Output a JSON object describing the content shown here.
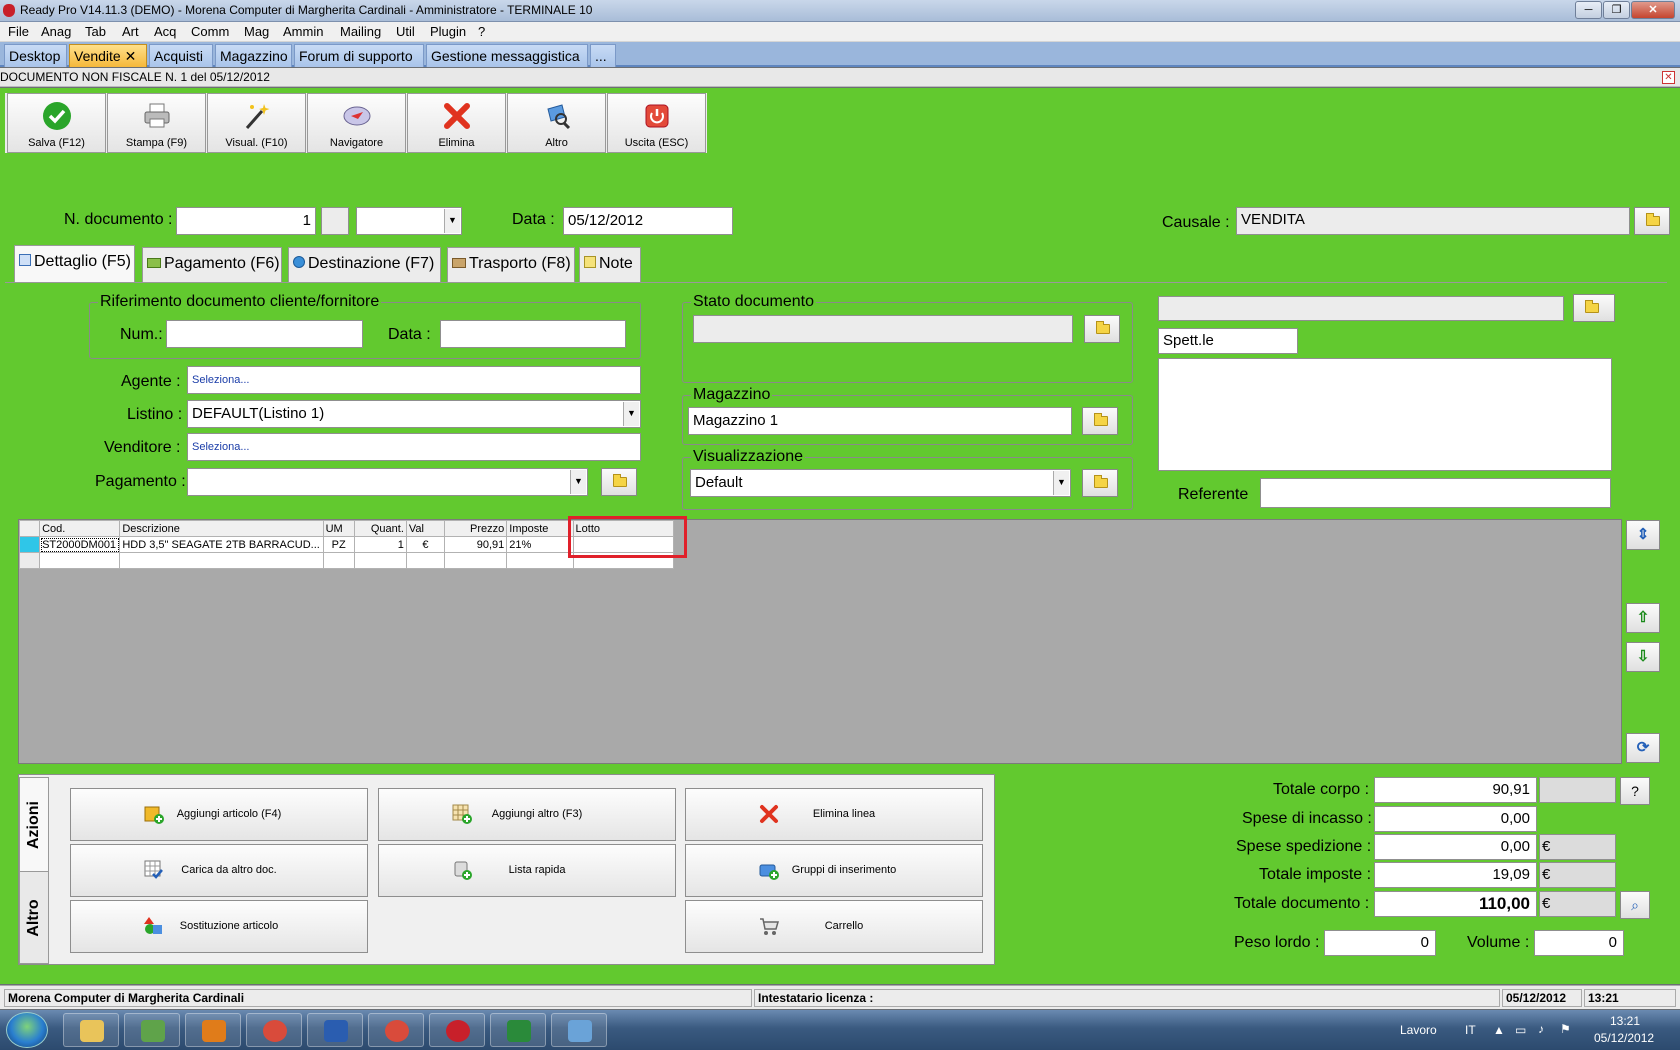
{
  "window": {
    "title": "Ready Pro V14.11.3 (DEMO)  - Morena Computer di Margherita Cardinali - Amministratore - TERMINALE 10"
  },
  "menu": [
    "File",
    "Anag",
    "Tab",
    "Art",
    "Acq",
    "Comm",
    "Mag",
    "Ammin",
    "Mailing",
    "Util",
    "Plugin",
    "?"
  ],
  "app_tabs": [
    {
      "label": "Desktop"
    },
    {
      "label": "Vendite ✕",
      "active": true
    },
    {
      "label": "Acquisti"
    },
    {
      "label": "Magazzino"
    },
    {
      "label": "Forum di supporto"
    },
    {
      "label": "Gestione messaggistica"
    },
    {
      "label": "..."
    }
  ],
  "document": {
    "header": "DOCUMENTO NON FISCALE N. 1  del 05/12/2012"
  },
  "toolbar": {
    "save": "Salva (F12)",
    "print": "Stampa (F9)",
    "view": "Visual. (F10)",
    "navigator": "Navigatore",
    "delete": "Elimina",
    "other": "Altro",
    "exit": "Uscita (ESC)"
  },
  "form": {
    "doc_number_label": "N. documento :",
    "doc_number": "1",
    "series": "",
    "date_label": "Data :",
    "date": "05/12/2012",
    "causale_label": "Causale :",
    "causale": "VENDITA"
  },
  "inner_tabs": {
    "detail": "Dettaglio (F5)",
    "payment": "Pagamento (F6)",
    "destination": "Destinazione (F7)",
    "transport": "Trasporto (F8)",
    "notes": "Note"
  },
  "detail": {
    "ref_group": "Riferimento documento cliente/fornitore",
    "num_label": "Num.:",
    "num": "",
    "ref_date_label": "Data :",
    "ref_date": "",
    "agent_label": "Agente :",
    "agent": "Seleziona...",
    "listino_label": "Listino :",
    "listino": "DEFAULT(Listino 1)",
    "seller_label": "Venditore :",
    "seller": "Seleziona...",
    "payment_label": "Pagamento :",
    "payment": "",
    "status_group": "Stato documento",
    "status": "",
    "warehouse_group": "Magazzino",
    "warehouse": "Magazzino 1",
    "view_group": "Visualizzazione",
    "view": "Default",
    "customer_name": "",
    "salutation": "Spett.le",
    "address": "",
    "referente_label": "Referente",
    "referente": ""
  },
  "grid": {
    "columns": [
      "Cod.",
      "Descrizione",
      "UM",
      "Quant.",
      "Val",
      "Prezzo",
      "Imposte",
      "Lotto"
    ],
    "rows": [
      [
        "ST2000DM001",
        "HDD 3,5\" SEAGATE 2TB BARRACUD...",
        "PZ",
        "1",
        "€",
        "90,91",
        "21%",
        ""
      ]
    ]
  },
  "actions": {
    "tab_actions": "Azioni",
    "tab_other": "Altro",
    "add_article": "Aggiungi articolo (F4)",
    "add_other": "Aggiungi altro (F3)",
    "delete_line": "Elimina linea",
    "load_doc": "Carica da altro doc.",
    "quick_list": "Lista rapida",
    "insert_groups": "Gruppi di inserimento",
    "replace": "Sostituzione articolo",
    "cart": "Carrello"
  },
  "totals": {
    "body_label": "Totale corpo :",
    "body": "90,91",
    "help": "?",
    "collection_label": "Spese di incasso :",
    "collection": "0,00",
    "shipping_label": "Spese spedizione :",
    "shipping": "0,00",
    "shipping_cur": "€",
    "tax_label": "Totale imposte :",
    "tax": "19,09",
    "tax_cur": "€",
    "doc_label": "Totale documento :",
    "doc": "110,00",
    "doc_cur": "€",
    "weight_label": "Peso lordo :",
    "weight": "0",
    "volume_label": "Volume :",
    "volume": "0"
  },
  "status": {
    "company": "Morena Computer di Margherita Cardinali",
    "licensee": "Intestatario licenza :",
    "date": "05/12/2012",
    "time": "13:21"
  },
  "taskbar": {
    "lavoro": "Lavoro",
    "lang": "IT",
    "time": "13:21",
    "date": "05/12/2012"
  }
}
